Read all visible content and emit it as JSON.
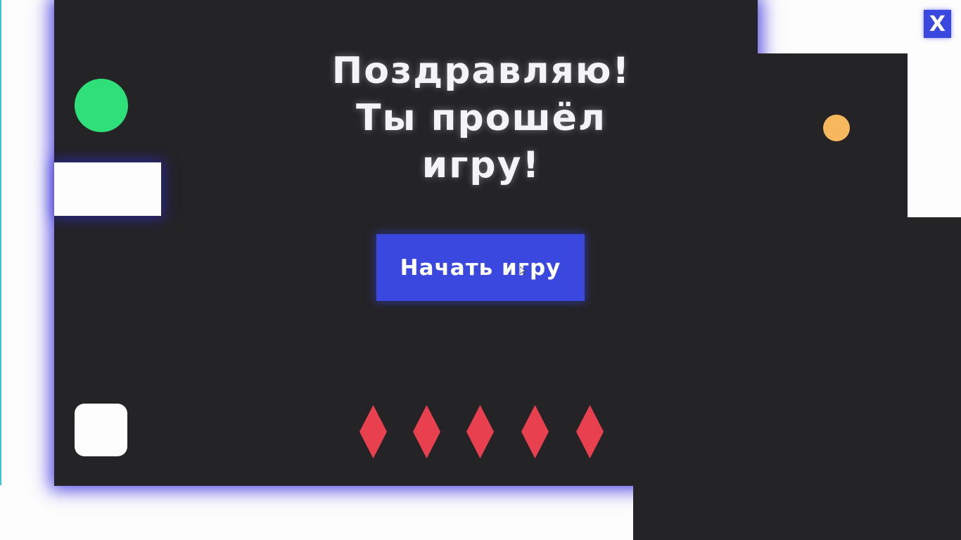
{
  "close_button": {
    "label": "X",
    "color": "#3b48e0"
  },
  "dialog": {
    "title_lines": [
      "Поздравляю!",
      "Ты прошёл",
      "игру!"
    ],
    "start_button_label": "Начать игру"
  },
  "level": {
    "player": "green-circle",
    "coin": "orange-circle",
    "block": "white-rounded-square",
    "spike_count": 5
  },
  "colors": {
    "background_dark": "#242326",
    "wall": "#fdfdfd",
    "glow": "#3228dc",
    "accent": "#3b48e0",
    "player": "#2fe07a",
    "coin": "#f7b85d",
    "spike": "#e8404f"
  }
}
